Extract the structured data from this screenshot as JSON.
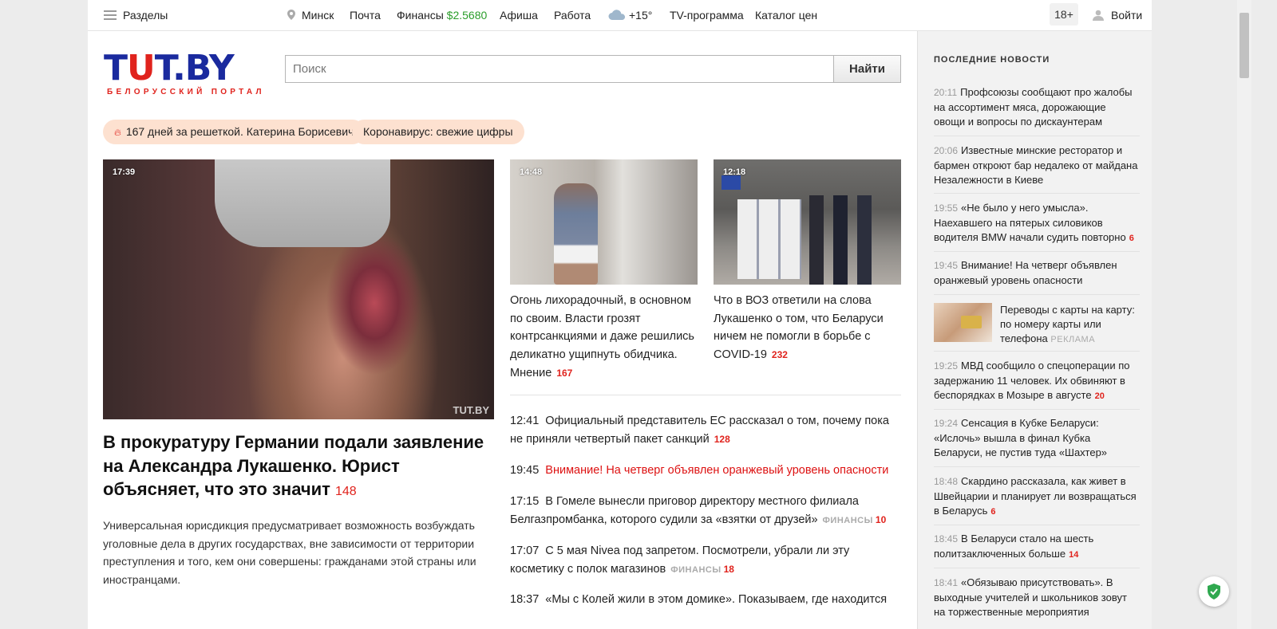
{
  "topbar": {
    "sections_label": "Разделы",
    "city": "Минск",
    "mail": "Почта",
    "finance_label": "Финансы",
    "finance_value": "$2.5680",
    "afisha": "Афиша",
    "work": "Работа",
    "weather": "+15°",
    "tv": "TV-программа",
    "prices": "Каталог цен",
    "age": "18+",
    "login": "Войти"
  },
  "logo": {
    "main_1": "T",
    "main_red": "U",
    "main_2": "T.BY",
    "subtitle": "БЕЛОРУССКИЙ ПОРТАЛ"
  },
  "search": {
    "placeholder": "Поиск",
    "button": "Найти"
  },
  "chips": [
    {
      "label": "167 дней за решеткой. Катерина Борисевич"
    },
    {
      "label": "Коронавирус: свежие цифры"
    }
  ],
  "main_story": {
    "time": "17:39",
    "watermark": "TUT.BY",
    "title": "В прокуратуру Германии подали заявление на Александра Лукашенко. Юрист объясняет, что это значит",
    "comments": "148",
    "lead": "Универсальная юрисдикция предусматривает возможность возбуждать уголовные дела в других государствах, вне зависимости от территории преступления и того, кем они совершены: гражданами этой страны или иностранцами."
  },
  "cards": [
    {
      "time": "14:48",
      "title": "Огонь лихорадочный, в основном по своим. Власти грозят контрсанкциями и даже решились деликатно ущипнуть обидчика. Мнение",
      "comments": "167"
    },
    {
      "time": "12:18",
      "title": "Что в ВОЗ ответили на слова Лукашенко о том, что Беларуси ничем не помогли в борьбе с COVID-19",
      "comments": "232"
    }
  ],
  "news": [
    {
      "time": "12:41",
      "text": "Официальный представитель ЕС рассказал о том, почему пока не приняли четвертый пакет санкций",
      "tag": "",
      "comments": "128"
    },
    {
      "time": "19:45",
      "text": "Внимание! На четверг объявлен оранжевый уровень опасности",
      "tag": "",
      "comments": ""
    },
    {
      "time": "17:15",
      "text": "В Гомеле вынесли приговор директору местного филиала Белгазпромбанка, которого судили за «взятки от друзей»",
      "tag": "ФИНАНСЫ",
      "comments": "10"
    },
    {
      "time": "17:07",
      "text": "С 5 мая Nivea под запретом. Посмотрели, убрали ли эту косметику с полок магазинов",
      "tag": "ФИНАНСЫ",
      "comments": "18"
    },
    {
      "time": "18:37",
      "text": "«Мы с Колей жили в этом домике». Показываем, где находится",
      "tag": "",
      "comments": ""
    }
  ],
  "sidebar": {
    "heading": "ПОСЛЕДНИЕ НОВОСТИ",
    "items": [
      {
        "time": "20:11",
        "text": "Профсоюзы сообщают про жалобы на ассортимент мяса, дорожающие овощи и вопросы по дискаунтерам",
        "comments": ""
      },
      {
        "time": "20:06",
        "text": "Известные минские ресторатор и бармен откроют бар недалеко от майдана Незалежности в Киеве",
        "comments": ""
      },
      {
        "time": "19:55",
        "text": "«Не было у него умысла». Наехавшего на пятерых силовиков водителя BMW начали судить повторно",
        "comments": "6"
      },
      {
        "time": "19:45",
        "text": "Внимание! На четверг объявлен оранжевый уровень опасности",
        "comments": ""
      },
      {
        "time": "19:25",
        "text": "МВД сообщило о спецоперации по задержанию 11 человек. Их обвиняют в беспорядках в Мозыре в августе",
        "comments": "20"
      },
      {
        "time": "19:24",
        "text": "Сенсация в Кубке Беларуси: «Ислочь» вышла в финал Кубка Беларуси, не пустив туда «Шахтер»",
        "comments": ""
      },
      {
        "time": "18:48",
        "text": "Скардино рассказала, как живет в Швейцарии и планирует ли возвращаться в Беларусь",
        "comments": "6"
      },
      {
        "time": "18:45",
        "text": "В Беларуси стало на шесть политзаключенных больше",
        "comments": "14"
      },
      {
        "time": "18:41",
        "text": "«Обязываю присутствовать». В выходные учителей и школьников зовут на торжественные мероприятия",
        "comments": ""
      }
    ],
    "ad": {
      "text": "Переводы с карты на карту: по номеру карты или телефона",
      "tag": "РЕКЛАМА"
    }
  }
}
